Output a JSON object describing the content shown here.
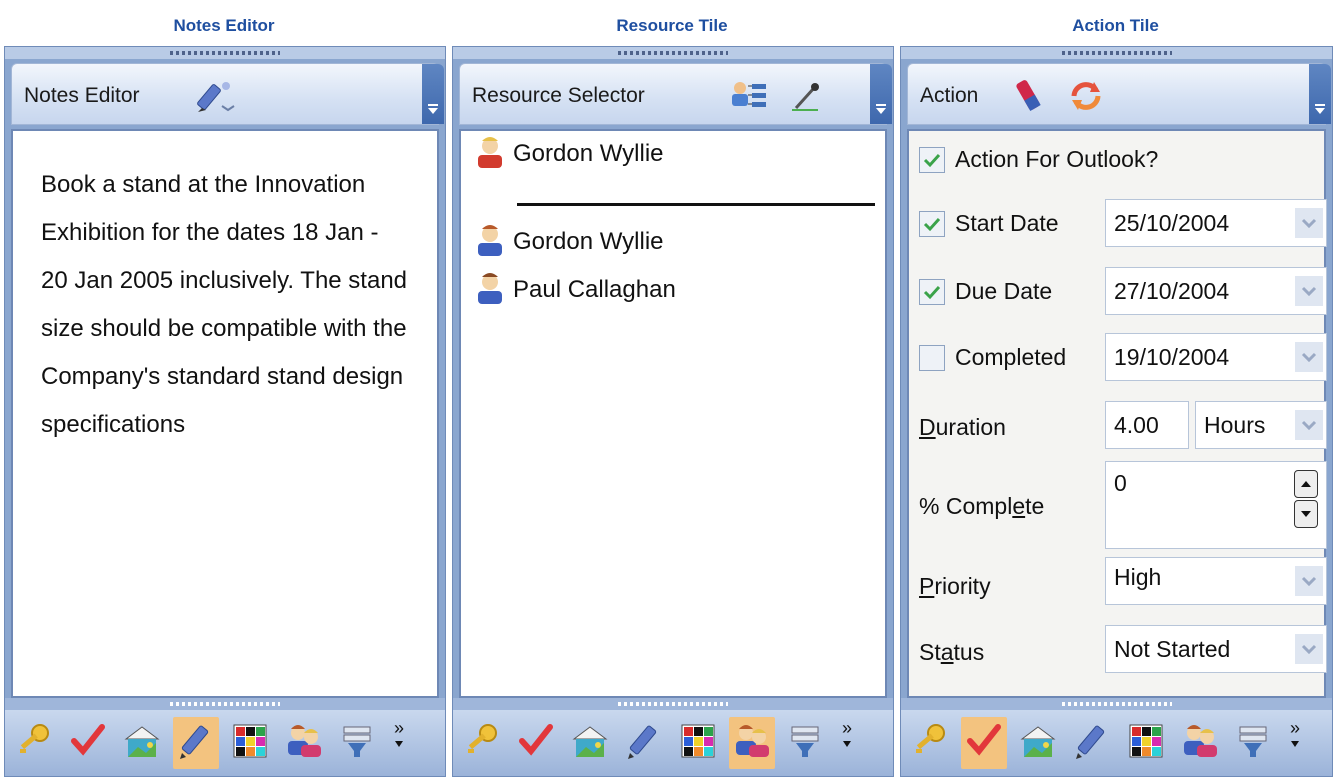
{
  "captions": {
    "notes": "Notes Editor",
    "resource": "Resource Tile",
    "action": "Action Tile"
  },
  "notes": {
    "title": "Notes Editor",
    "header_icon": "pencil-icon",
    "text": "Book a stand at the Innovation Exhibition for the dates 18 Jan - 20 Jan 2005 inclusively. The stand size should be compatible with the Company's standard stand design specifications"
  },
  "resource": {
    "title": "Resource Selector",
    "header_icons": [
      "org-chart-icon",
      "eyedropper-icon"
    ],
    "selected": "Gordon Wyllie",
    "list": [
      "Gordon Wyllie",
      "Paul Callaghan"
    ]
  },
  "action": {
    "title": "Action",
    "header_icons": [
      "eraser-icon",
      "refresh-icon"
    ],
    "outlook_label": "Action For Outlook?",
    "outlook_checked": true,
    "start_label": "Start Date",
    "start_checked": true,
    "start_value": "25/10/2004",
    "due_label": "Due Date",
    "due_checked": true,
    "due_value": "27/10/2004",
    "completed_label": "Completed",
    "completed_checked": false,
    "completed_value": "19/10/2004",
    "duration_label_u": "D",
    "duration_label_rest": "uration",
    "duration_value": "4.00",
    "duration_unit": "Hours",
    "percent_label_a": "% Compl",
    "percent_label_u": "e",
    "percent_label_b": "te",
    "percent_value": "0",
    "priority_label_u": "P",
    "priority_label_rest": "riority",
    "priority_value": "High",
    "status_label_a": "St",
    "status_label_u": "a",
    "status_label_b": "tus",
    "status_value": "Not Started"
  },
  "toolbar": {
    "icons": [
      "key-icon",
      "checkmark-icon",
      "picture-icon",
      "pencil-icon",
      "color-grid-icon",
      "people-icon",
      "filter-icon"
    ],
    "more": "»",
    "notes_active": 3,
    "resource_active": 5,
    "action_active": 1
  },
  "colors": {
    "caption": "#1f4fa0",
    "panel_frame": "#8aa6cf",
    "active_tool": "#f3c37f",
    "check_green": "#3aa34a"
  }
}
